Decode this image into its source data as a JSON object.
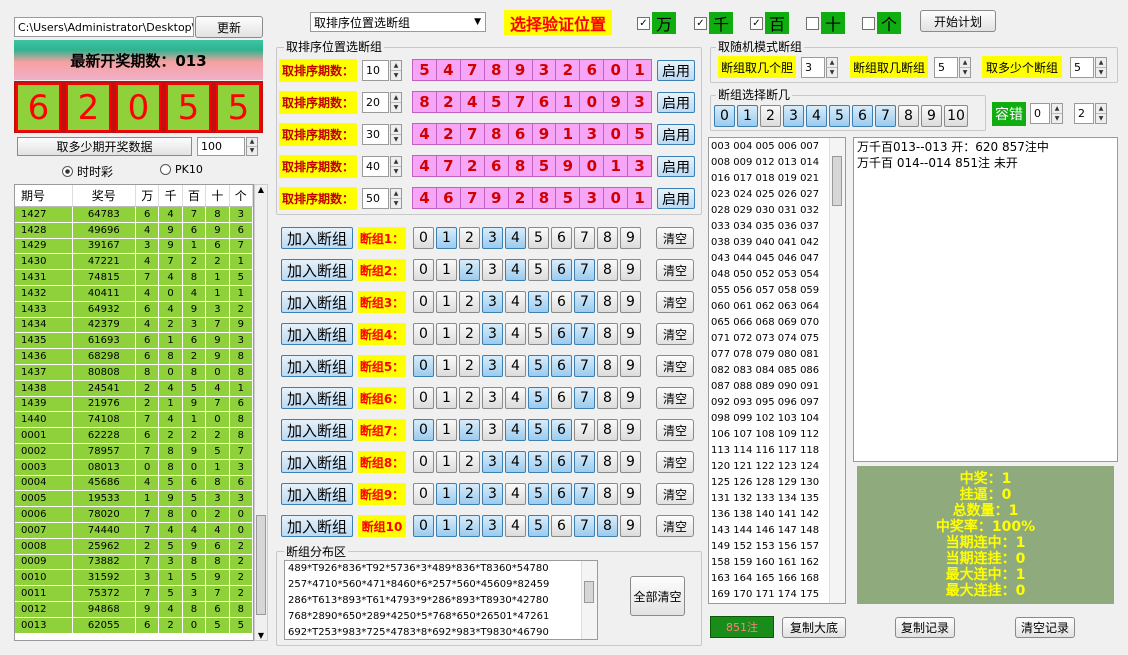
{
  "top": {
    "path": "C:\\Users\\Administrator\\Desktop\\",
    "update": "更新",
    "mode_select": "取排序位置选断组",
    "verify_label": "选择验证位置",
    "start_plan": "开始计划",
    "checks": [
      {
        "label": "万",
        "checked": true
      },
      {
        "label": "千",
        "checked": true
      },
      {
        "label": "百",
        "checked": true
      },
      {
        "label": "十",
        "checked": false
      },
      {
        "label": "个",
        "checked": false
      }
    ]
  },
  "latest": {
    "title": "最新开奖期数：013",
    "digits": [
      "6",
      "2",
      "0",
      "5",
      "5"
    ]
  },
  "fetch": {
    "label": "取多少期开奖数据",
    "value": "100"
  },
  "radios": [
    {
      "label": "时时彩",
      "checked": true
    },
    {
      "label": "PK10",
      "checked": false
    }
  ],
  "table": {
    "headers": [
      "期号",
      "奖号",
      "万",
      "千",
      "百",
      "十",
      "个"
    ],
    "rows": [
      [
        "1427",
        "64783",
        "6",
        "4",
        "7",
        "8",
        "3"
      ],
      [
        "1428",
        "49696",
        "4",
        "9",
        "6",
        "9",
        "6"
      ],
      [
        "1429",
        "39167",
        "3",
        "9",
        "1",
        "6",
        "7"
      ],
      [
        "1430",
        "47221",
        "4",
        "7",
        "2",
        "2",
        "1"
      ],
      [
        "1431",
        "74815",
        "7",
        "4",
        "8",
        "1",
        "5"
      ],
      [
        "1432",
        "40411",
        "4",
        "0",
        "4",
        "1",
        "1"
      ],
      [
        "1433",
        "64932",
        "6",
        "4",
        "9",
        "3",
        "2"
      ],
      [
        "1434",
        "42379",
        "4",
        "2",
        "3",
        "7",
        "9"
      ],
      [
        "1435",
        "61693",
        "6",
        "1",
        "6",
        "9",
        "3"
      ],
      [
        "1436",
        "68298",
        "6",
        "8",
        "2",
        "9",
        "8"
      ],
      [
        "1437",
        "80808",
        "8",
        "0",
        "8",
        "0",
        "8"
      ],
      [
        "1438",
        "24541",
        "2",
        "4",
        "5",
        "4",
        "1"
      ],
      [
        "1439",
        "21976",
        "2",
        "1",
        "9",
        "7",
        "6"
      ],
      [
        "1440",
        "74108",
        "7",
        "4",
        "1",
        "0",
        "8"
      ],
      [
        "0001",
        "62228",
        "6",
        "2",
        "2",
        "2",
        "8"
      ],
      [
        "0002",
        "78957",
        "7",
        "8",
        "9",
        "5",
        "7"
      ],
      [
        "0003",
        "08013",
        "0",
        "8",
        "0",
        "1",
        "3"
      ],
      [
        "0004",
        "45686",
        "4",
        "5",
        "6",
        "8",
        "6"
      ],
      [
        "0005",
        "19533",
        "1",
        "9",
        "5",
        "3",
        "3"
      ],
      [
        "0006",
        "78020",
        "7",
        "8",
        "0",
        "2",
        "0"
      ],
      [
        "0007",
        "74440",
        "7",
        "4",
        "4",
        "4",
        "0"
      ],
      [
        "0008",
        "25962",
        "2",
        "5",
        "9",
        "6",
        "2"
      ],
      [
        "0009",
        "73882",
        "7",
        "3",
        "8",
        "8",
        "2"
      ],
      [
        "0010",
        "31592",
        "3",
        "1",
        "5",
        "9",
        "2"
      ],
      [
        "0011",
        "75372",
        "7",
        "5",
        "3",
        "7",
        "2"
      ],
      [
        "0012",
        "94868",
        "9",
        "4",
        "8",
        "6",
        "8"
      ],
      [
        "0013",
        "62055",
        "6",
        "2",
        "0",
        "5",
        "5"
      ]
    ]
  },
  "sort_group": {
    "title": "取排序位置选断组",
    "enable": "启用",
    "rows": [
      {
        "label": "取排序期数：",
        "periods": "10",
        "digits": [
          "5",
          "4",
          "7",
          "8",
          "9",
          "3",
          "2",
          "6",
          "0",
          "1"
        ]
      },
      {
        "label": "取排序期数：",
        "periods": "20",
        "digits": [
          "8",
          "2",
          "4",
          "5",
          "7",
          "6",
          "1",
          "0",
          "9",
          "3"
        ]
      },
      {
        "label": "取排序期数：",
        "periods": "30",
        "digits": [
          "4",
          "2",
          "7",
          "8",
          "6",
          "9",
          "1",
          "3",
          "0",
          "5"
        ]
      },
      {
        "label": "取排序期数：",
        "periods": "40",
        "digits": [
          "4",
          "7",
          "2",
          "6",
          "8",
          "5",
          "9",
          "0",
          "1",
          "3"
        ]
      },
      {
        "label": "取排序期数：",
        "periods": "50",
        "digits": [
          "4",
          "6",
          "7",
          "9",
          "2",
          "8",
          "5",
          "3",
          "0",
          "1"
        ]
      }
    ]
  },
  "groups": {
    "add": "加入断组",
    "clear": "清空",
    "rows": [
      {
        "label": "断组1：",
        "on": [
          1,
          3,
          4
        ]
      },
      {
        "label": "断组2：",
        "on": [
          2,
          4,
          6,
          7
        ]
      },
      {
        "label": "断组3：",
        "on": [
          3,
          5,
          7
        ]
      },
      {
        "label": "断组4：",
        "on": [
          3,
          6,
          7
        ]
      },
      {
        "label": "断组5：",
        "on": [
          0,
          3,
          5,
          6,
          7
        ]
      },
      {
        "label": "断组6：",
        "on": [
          5,
          7
        ]
      },
      {
        "label": "断组7：",
        "on": [
          0,
          2,
          4,
          5,
          6
        ]
      },
      {
        "label": "断组8：",
        "on": [
          3,
          4,
          5,
          6,
          7
        ]
      },
      {
        "label": "断组9：",
        "on": [
          1,
          2,
          3,
          5,
          6,
          7
        ]
      },
      {
        "label": "断组10",
        "on": [
          0,
          1,
          2,
          3,
          5,
          7,
          8
        ]
      }
    ]
  },
  "dist": {
    "title": "断组分布区",
    "lines": [
      "489*T926*836*T92*5736*3*489*836*T8360*54780",
      "257*4710*560*471*8460*6*257*560*45609*82459",
      "286*T613*893*T61*4793*9*286*893*T8930*42780",
      "768*2890*650*289*4250*5*768*650*26501*47261",
      "692*T253*983*725*4783*8*692*983*T9830*46790"
    ],
    "clear_all": "全部清空"
  },
  "random": {
    "title": "取随机模式断组",
    "items": [
      {
        "label": "断组取几个胆",
        "value": "3"
      },
      {
        "label": "断组取几断组",
        "value": "5"
      },
      {
        "label": "取多少个断组",
        "value": "5"
      }
    ],
    "choose_title": "断组选择断几",
    "choose": [
      "0",
      "1",
      "2",
      "3",
      "4",
      "5",
      "6",
      "7",
      "8",
      "9",
      "10"
    ],
    "choose_on": [
      0,
      1,
      3,
      4,
      5,
      6,
      7
    ],
    "tolerance": "容错",
    "tol_a": "0",
    "tol_b": "2"
  },
  "combos": [
    "003 004 005 006 007",
    "008 009 012 013 014",
    "016 017 018 019 021",
    "023 024 025 026 027",
    "028 029 030 031 032",
    "033 034 035 036 037",
    "038 039 040 041 042",
    "043 044 045 046 047",
    "048 050 052 053 054",
    "055 056 057 058 059",
    "060 061 062 063 064",
    "065 066 068 069 070",
    "071 072 073 074 075",
    "077 078 079 080 081",
    "082 083 084 085 086",
    "087 088 089 090 091",
    "092 093 095 096 097",
    "098 099 102 103 104",
    "106 107 108 109 112",
    "113 114 116 117 118",
    "120 121 122 123 124",
    "125 126 128 129 130",
    "131 132 133 134 135",
    "136 138 140 141 142",
    "143 144 146 147 148",
    "149 152 153 156 157",
    "158 159 160 161 162",
    "163 164 165 166 168",
    "169 170 171 174 175"
  ],
  "log": [
    "万千百013--013 开：620 857注中",
    "万千百 014--014 851注 未开"
  ],
  "stats": [
    "中奖：1",
    "挂逼：0",
    "总数量：1",
    "中奖率：100%",
    "当期连中：1",
    "当期连挂：0",
    "最大连中：1",
    "最大连挂：0"
  ],
  "bottom": {
    "count": "851注",
    "copy_big": "复制大底",
    "copy_rec": "复制记录",
    "clear_rec": "清空记录"
  }
}
